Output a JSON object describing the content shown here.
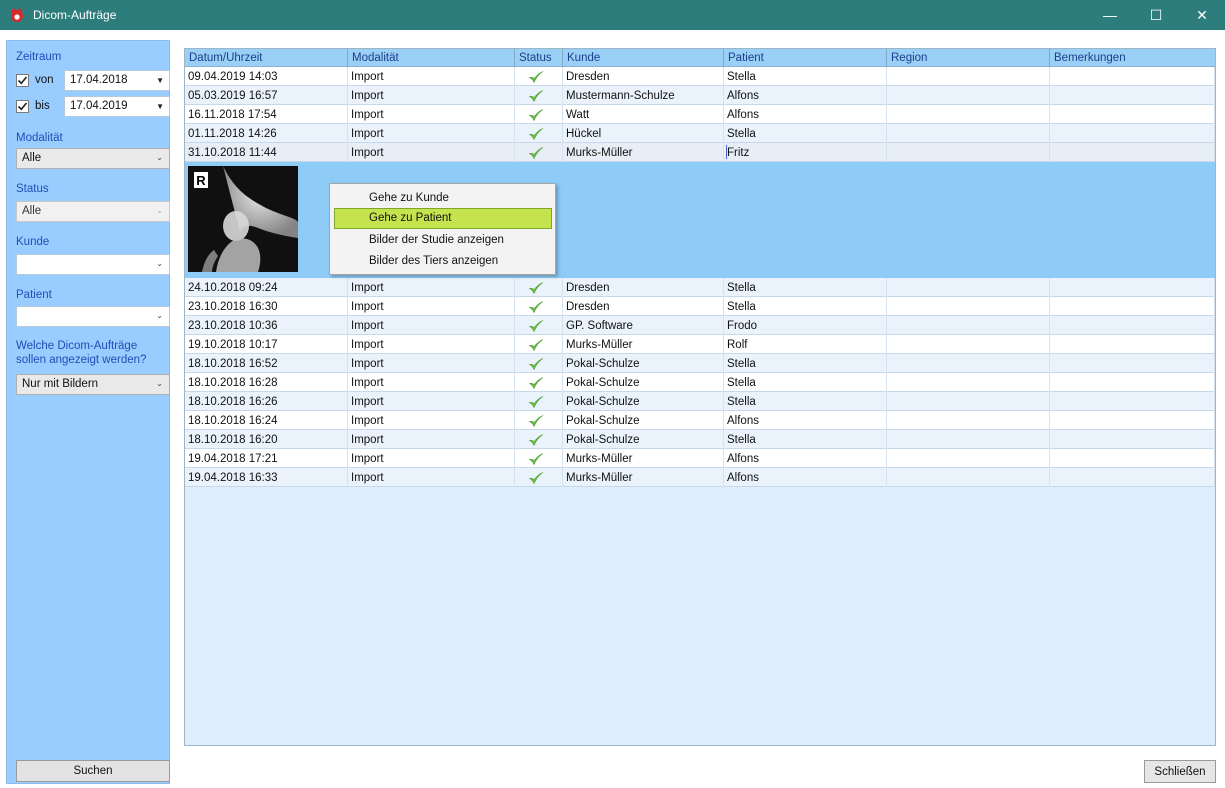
{
  "window": {
    "title": "Dicom-Aufträge",
    "minimize": "—",
    "maximize": "☐",
    "close": "✕"
  },
  "sidebar": {
    "zeitraum_label": "Zeitraum",
    "von_label": "von",
    "von_checked": true,
    "von_date": "17.04.2018",
    "bis_label": "bis",
    "bis_checked": true,
    "bis_date": "17.04.2019",
    "modalitaet_label": "Modalität",
    "modalitaet_value": "Alle",
    "status_label": "Status",
    "status_value": "Alle",
    "kunde_label": "Kunde",
    "kunde_value": "",
    "patient_label": "Patient",
    "patient_value": "",
    "filter_label_line1": "Welche Dicom-Aufträge",
    "filter_label_line2": "sollen angezeigt werden?",
    "filter_value": "Nur mit Bildern",
    "search_button": "Suchen"
  },
  "grid": {
    "columns": [
      "Datum/Uhrzeit",
      "Modalität",
      "Status",
      "Kunde",
      "Patient",
      "Region",
      "Bemerkungen"
    ],
    "rows_top": [
      {
        "datum": "09.04.2019 14:03",
        "modalitaet": "Import",
        "kunde": "Dresden",
        "patient": "Stella"
      },
      {
        "datum": "05.03.2019 16:57",
        "modalitaet": "Import",
        "kunde": "Mustermann-Schulze",
        "patient": "Alfons"
      },
      {
        "datum": "16.11.2018 17:54",
        "modalitaet": "Import",
        "kunde": "Watt",
        "patient": "Alfons"
      },
      {
        "datum": "01.11.2018 14:26",
        "modalitaet": "Import",
        "kunde": "Hückel",
        "patient": "Stella"
      },
      {
        "datum": "31.10.2018 11:44",
        "modalitaet": "Import",
        "kunde": "Murks-Müller",
        "patient": "Fritz"
      }
    ],
    "rows_bottom": [
      {
        "datum": "24.10.2018 09:24",
        "modalitaet": "Import",
        "kunde": "Dresden",
        "patient": "Stella"
      },
      {
        "datum": "23.10.2018 16:30",
        "modalitaet": "Import",
        "kunde": "Dresden",
        "patient": "Stella"
      },
      {
        "datum": "23.10.2018 10:36",
        "modalitaet": "Import",
        "kunde": "GP. Software",
        "patient": "Frodo"
      },
      {
        "datum": "19.10.2018 10:17",
        "modalitaet": "Import",
        "kunde": "Murks-Müller",
        "patient": "Rolf"
      },
      {
        "datum": "18.10.2018 16:52",
        "modalitaet": "Import",
        "kunde": "Pokal-Schulze",
        "patient": "Stella"
      },
      {
        "datum": "18.10.2018 16:28",
        "modalitaet": "Import",
        "kunde": "Pokal-Schulze",
        "patient": "Stella"
      },
      {
        "datum": "18.10.2018 16:26",
        "modalitaet": "Import",
        "kunde": "Pokal-Schulze",
        "patient": "Stella"
      },
      {
        "datum": "18.10.2018 16:24",
        "modalitaet": "Import",
        "kunde": "Pokal-Schulze",
        "patient": "Alfons"
      },
      {
        "datum": "18.10.2018 16:20",
        "modalitaet": "Import",
        "kunde": "Pokal-Schulze",
        "patient": "Stella"
      },
      {
        "datum": "19.04.2018 17:21",
        "modalitaet": "Import",
        "kunde": "Murks-Müller",
        "patient": "Alfons"
      },
      {
        "datum": "19.04.2018 16:33",
        "modalitaet": "Import",
        "kunde": "Murks-Müller",
        "patient": "Alfons"
      }
    ],
    "status_icon": "green-checkmark-icon",
    "xray_marker": "R"
  },
  "context_menu": {
    "items": [
      "Gehe zu Kunde",
      "Gehe zu Patient",
      "Bilder der Studie anzeigen",
      "Bilder des Tiers anzeigen"
    ],
    "highlighted_index": 1
  },
  "close_button": "Schließen",
  "colors": {
    "titlebar": "#2e7d7d",
    "sidebar": "#99ccff",
    "label_blue": "#1f4fb5",
    "header": "#9bd0f6",
    "detail_row": "#8ecbf6",
    "menu_highlight": "#c5e34d",
    "check_green": "#6cc24a"
  }
}
